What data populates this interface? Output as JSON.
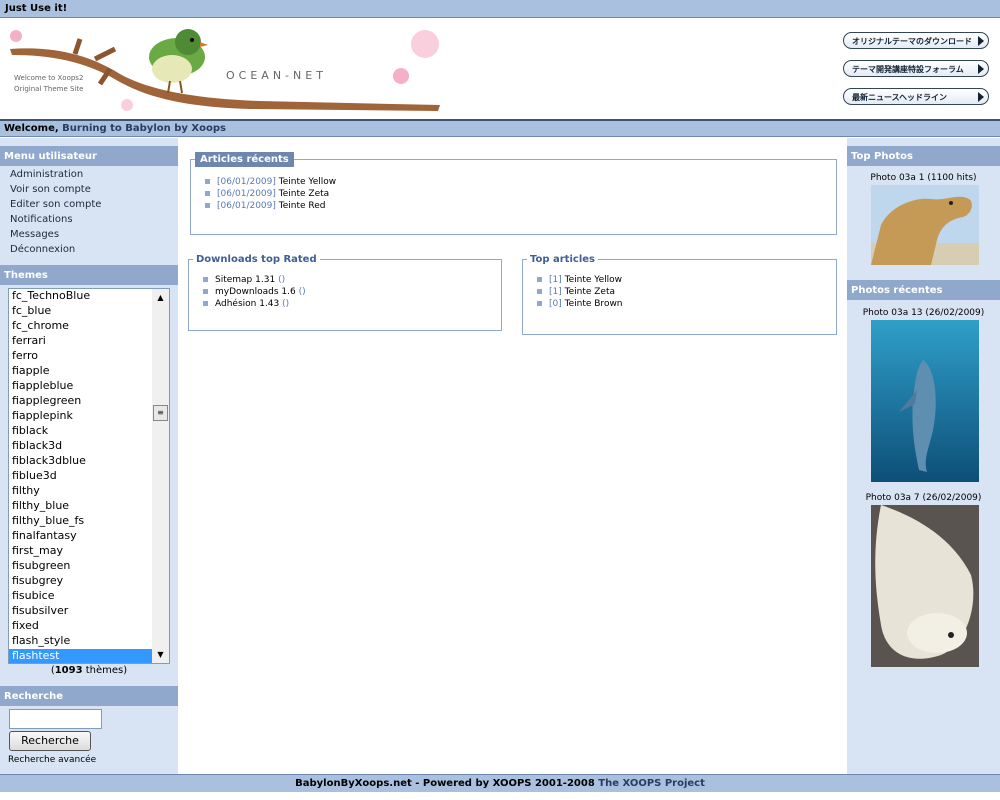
{
  "topbar": {
    "text": "Just Use it!"
  },
  "header": {
    "caption_line1": "Welcome to Xoops2",
    "caption_line2": "Original Theme Site",
    "logo": "OCEAN-NET",
    "buttons": [
      "オリジナルテーマのダウンロード",
      "テーマ開発講座特設フォーラム",
      "最新ニュースヘッドライン"
    ]
  },
  "welcome": {
    "prefix": "Welcome, ",
    "site": "Burning to Babylon by Xoops"
  },
  "user_menu": {
    "title": "Menu utilisateur",
    "items": [
      "Administration",
      "Voir son compte",
      "Editer son compte",
      "Notifications",
      "Messages",
      "Déconnexion"
    ]
  },
  "themes": {
    "title": "Themes",
    "options": [
      "fc_TechnoBlue",
      "fc_blue",
      "fc_chrome",
      "ferrari",
      "ferro",
      "fiapple",
      "fiappleblue",
      "fiapplegreen",
      "fiapplepink",
      "fiblack",
      "fiblack3d",
      "fiblack3dblue",
      "fiblue3d",
      "filthy",
      "filthy_blue",
      "filthy_blue_fs",
      "finalfantasy",
      "first_may",
      "fisubgreen",
      "fisubgrey",
      "fisubice",
      "fisubsilver",
      "fixed",
      "flash_style",
      "flashtest"
    ],
    "selected": "flashtest",
    "count_open": "(",
    "count": "1093",
    "count_suffix": " thèmes)"
  },
  "search": {
    "title": "Recherche",
    "button": "Recherche",
    "input_value": "",
    "advanced": "Recherche avancée"
  },
  "recent_articles": {
    "title": "Articles récents",
    "items": [
      {
        "date": "[06/01/2009]",
        "title": "Teinte Yellow"
      },
      {
        "date": "[06/01/2009]",
        "title": "Teinte Zeta"
      },
      {
        "date": "[06/01/2009]",
        "title": "Teinte Red"
      }
    ]
  },
  "downloads": {
    "title": "Downloads top Rated",
    "items": [
      {
        "name": "Sitemap 1.31",
        "rating": "()"
      },
      {
        "name": "myDownloads 1.6",
        "rating": "()"
      },
      {
        "name": "Adhésion 1.43",
        "rating": "()"
      }
    ]
  },
  "top_articles": {
    "title": "Top articles",
    "items": [
      {
        "hits": "[1]",
        "title": "Teinte Yellow"
      },
      {
        "hits": "[1]",
        "title": "Teinte Zeta"
      },
      {
        "hits": "[0]",
        "title": "Teinte Brown"
      }
    ]
  },
  "top_photos": {
    "title": "Top Photos",
    "items": [
      {
        "caption": "Photo 03a 1 (1100 hits)"
      }
    ]
  },
  "recent_photos": {
    "title": "Photos récentes",
    "items": [
      {
        "caption": "Photo 03a 13 (26/02/2009)"
      },
      {
        "caption": "Photo 03a 7 (26/02/2009)"
      }
    ]
  },
  "footer": {
    "main": "BabylonByXoops.net - Powered by XOOPS 2001-2008 ",
    "project": "The XOOPS Project"
  },
  "colors": {
    "bar": "#a9c0de",
    "sidebar": "#d8e4f4",
    "block_title": "#8fa8cc",
    "selection": "#3399ff",
    "link": "#5a7bb3"
  },
  "icons": [
    "scroll-up-icon",
    "scroll-down-icon",
    "scroll-thumb-icon",
    "arrow-right-icon",
    "bullet-icon"
  ]
}
